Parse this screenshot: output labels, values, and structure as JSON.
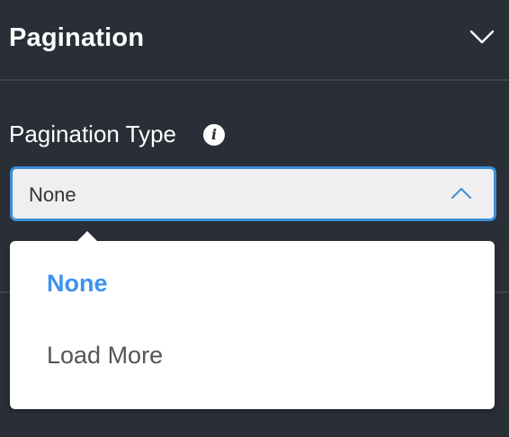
{
  "section": {
    "title": "Pagination",
    "toggle_icon": "chevron-down-icon"
  },
  "field": {
    "label": "Pagination Type",
    "info_icon": "info-icon",
    "info_glyph": "i"
  },
  "select": {
    "value": "None",
    "open": true,
    "toggle_icon": "chevron-up-icon",
    "options": [
      {
        "label": "None",
        "selected": true
      },
      {
        "label": "Load More",
        "selected": false
      }
    ]
  },
  "colors": {
    "panel_bg": "#2a2e37",
    "accent": "#3b94f0",
    "select_border": "#3b8fd9",
    "select_bg": "#efefef"
  }
}
